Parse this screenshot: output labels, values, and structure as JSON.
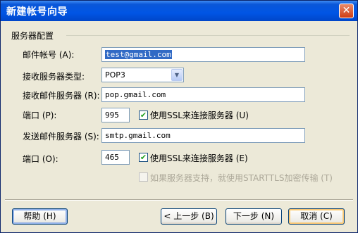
{
  "window": {
    "title": "新建帐号向导",
    "close_glyph": "✕"
  },
  "group": {
    "title": "服务器配置"
  },
  "account": {
    "label": "邮件帐号 (A):",
    "value": "test@gmail.com"
  },
  "server_type": {
    "label": "接收服务器类型:",
    "value": "POP3",
    "arrow": "▼"
  },
  "incoming": {
    "label": "接收邮件服务器 (R):",
    "value": "pop.gmail.com"
  },
  "incoming_port": {
    "label": "端口 (P):",
    "value": "995",
    "ssl_label": "使用SSL来连接服务器 (U)",
    "ssl_checked": true
  },
  "outgoing": {
    "label": "发送邮件服务器 (S):",
    "value": "smtp.gmail.com"
  },
  "outgoing_port": {
    "label": "端口 (O):",
    "value": "465",
    "ssl_label": "使用SSL来连接服务器 (E)",
    "ssl_checked": true
  },
  "starttls": {
    "label": "如果服务器支持，就使用STARTTLS加密传输 (T)",
    "checked": false,
    "enabled": false
  },
  "buttons": {
    "help": "帮助 (H)",
    "back": "< 上一步 (B)",
    "next": "下一步 (N)",
    "cancel": "取消 (C)"
  }
}
